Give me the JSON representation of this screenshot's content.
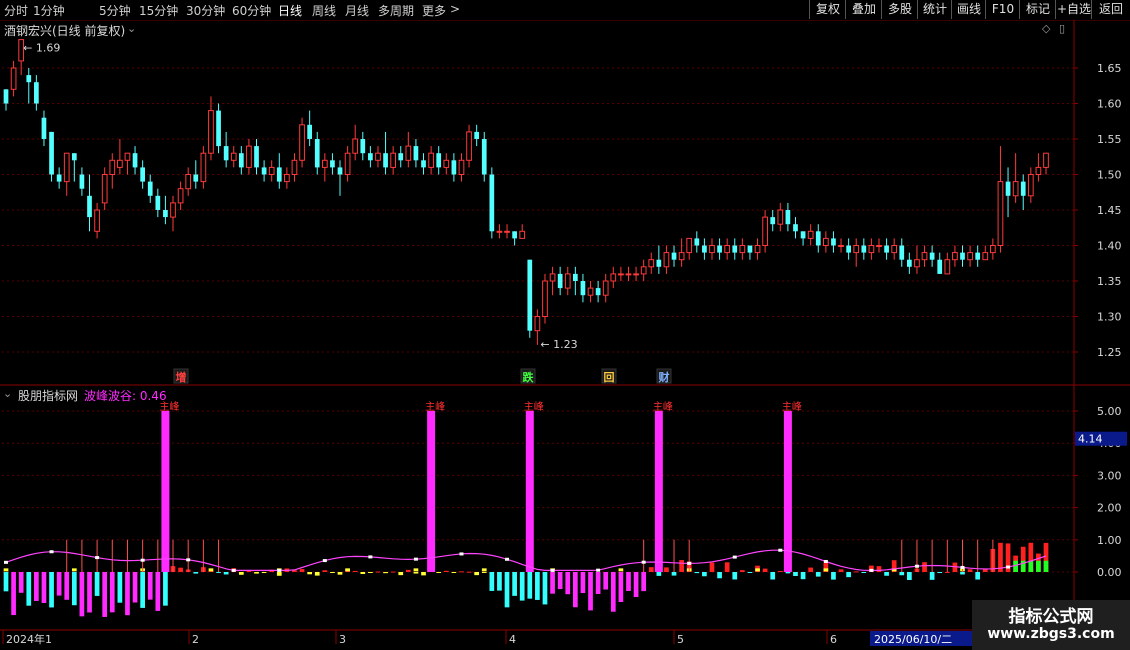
{
  "toolbar": {
    "periods": [
      "分时",
      "1分钟",
      "5分钟",
      "15分钟",
      "30分钟",
      "60分钟",
      "日线",
      "周线",
      "月线",
      "多周期",
      "更多"
    ],
    "active_period": "日线",
    "buttons": [
      "复权",
      "叠加",
      "多股",
      "统计",
      "画线",
      "F10",
      "标记",
      "+自选",
      "返回"
    ]
  },
  "main_panel": {
    "title": "酒钢宏兴(日线 前复权)",
    "max_label": "1.69",
    "min_label": "1.23",
    "y_ticks": [
      "1.65",
      "1.60",
      "1.55",
      "1.50",
      "1.45",
      "1.40",
      "1.35",
      "1.30",
      "1.25"
    ],
    "markers": [
      {
        "text": "增",
        "color": "#ff4040"
      },
      {
        "text": "跌",
        "color": "#40ff40"
      },
      {
        "text": "回",
        "color": "#ffcc44"
      },
      {
        "text": "财",
        "color": "#7fb0ff"
      }
    ]
  },
  "indicator_panel": {
    "name": "股朋指标网",
    "series_label": "波峰波谷: 0.46",
    "y_ticks": [
      "5.00",
      "4.00",
      "3.00",
      "2.00",
      "1.00",
      "0.00"
    ],
    "current_value": "4.14",
    "spike_label": "主峰"
  },
  "x_axis": {
    "labels": [
      "2024年1",
      "2",
      "3",
      "4",
      "5",
      "6"
    ],
    "date_box": "2025/06/10/二"
  },
  "watermark": {
    "line1": "指标公式网",
    "line2": "www.zbgs3.com"
  },
  "colors": {
    "up": "#ff3a3a",
    "down": "#54ffff",
    "grid": "#5a0000",
    "magenta": "#ff2bff",
    "axis": "#8a0000"
  },
  "chart_data": {
    "type": "candlestick",
    "price_axis": {
      "min": 1.23,
      "max": 1.69
    },
    "candles": [
      [
        1.62,
        1.6,
        1.62,
        1.59
      ],
      [
        1.62,
        1.65,
        1.66,
        1.61
      ],
      [
        1.66,
        1.69,
        1.69,
        1.64
      ],
      [
        1.64,
        1.63,
        1.65,
        1.6
      ],
      [
        1.63,
        1.6,
        1.64,
        1.59
      ],
      [
        1.58,
        1.55,
        1.59,
        1.54
      ],
      [
        1.56,
        1.5,
        1.56,
        1.49
      ],
      [
        1.5,
        1.49,
        1.51,
        1.48
      ],
      [
        1.49,
        1.53,
        1.53,
        1.47
      ],
      [
        1.53,
        1.52,
        1.53,
        1.49
      ],
      [
        1.5,
        1.48,
        1.51,
        1.47
      ],
      [
        1.47,
        1.44,
        1.5,
        1.42
      ],
      [
        1.42,
        1.45,
        1.46,
        1.41
      ],
      [
        1.46,
        1.5,
        1.51,
        1.45
      ],
      [
        1.5,
        1.52,
        1.53,
        1.48
      ],
      [
        1.51,
        1.52,
        1.55,
        1.5
      ],
      [
        1.52,
        1.53,
        1.53,
        1.5
      ],
      [
        1.53,
        1.51,
        1.54,
        1.5
      ],
      [
        1.51,
        1.49,
        1.52,
        1.48
      ],
      [
        1.49,
        1.47,
        1.5,
        1.46
      ],
      [
        1.47,
        1.45,
        1.48,
        1.44
      ],
      [
        1.45,
        1.44,
        1.47,
        1.43
      ],
      [
        1.44,
        1.46,
        1.47,
        1.42
      ],
      [
        1.46,
        1.48,
        1.49,
        1.45
      ],
      [
        1.48,
        1.5,
        1.51,
        1.47
      ],
      [
        1.5,
        1.49,
        1.52,
        1.48
      ],
      [
        1.49,
        1.53,
        1.54,
        1.48
      ],
      [
        1.53,
        1.59,
        1.61,
        1.52
      ],
      [
        1.59,
        1.54,
        1.6,
        1.53
      ],
      [
        1.54,
        1.52,
        1.56,
        1.51
      ],
      [
        1.52,
        1.53,
        1.54,
        1.51
      ],
      [
        1.53,
        1.51,
        1.54,
        1.5
      ],
      [
        1.51,
        1.54,
        1.55,
        1.5
      ],
      [
        1.54,
        1.51,
        1.55,
        1.5
      ],
      [
        1.51,
        1.5,
        1.52,
        1.49
      ],
      [
        1.5,
        1.51,
        1.52,
        1.49
      ],
      [
        1.51,
        1.49,
        1.53,
        1.48
      ],
      [
        1.49,
        1.5,
        1.51,
        1.48
      ],
      [
        1.5,
        1.52,
        1.53,
        1.49
      ],
      [
        1.52,
        1.57,
        1.58,
        1.51
      ],
      [
        1.57,
        1.55,
        1.59,
        1.54
      ],
      [
        1.55,
        1.51,
        1.56,
        1.5
      ],
      [
        1.51,
        1.52,
        1.53,
        1.49
      ],
      [
        1.52,
        1.51,
        1.53,
        1.5
      ],
      [
        1.51,
        1.5,
        1.52,
        1.47
      ],
      [
        1.5,
        1.53,
        1.54,
        1.49
      ],
      [
        1.53,
        1.55,
        1.57,
        1.52
      ],
      [
        1.55,
        1.53,
        1.56,
        1.52
      ],
      [
        1.53,
        1.52,
        1.54,
        1.51
      ],
      [
        1.52,
        1.53,
        1.54,
        1.51
      ],
      [
        1.53,
        1.51,
        1.56,
        1.5
      ],
      [
        1.51,
        1.53,
        1.54,
        1.5
      ],
      [
        1.53,
        1.52,
        1.54,
        1.51
      ],
      [
        1.52,
        1.54,
        1.56,
        1.51
      ],
      [
        1.54,
        1.52,
        1.55,
        1.51
      ],
      [
        1.52,
        1.51,
        1.53,
        1.5
      ],
      [
        1.51,
        1.53,
        1.54,
        1.5
      ],
      [
        1.53,
        1.51,
        1.54,
        1.5
      ],
      [
        1.51,
        1.52,
        1.53,
        1.5
      ],
      [
        1.52,
        1.5,
        1.53,
        1.49
      ],
      [
        1.5,
        1.52,
        1.53,
        1.49
      ],
      [
        1.52,
        1.56,
        1.57,
        1.51
      ],
      [
        1.56,
        1.55,
        1.57,
        1.54
      ],
      [
        1.55,
        1.5,
        1.56,
        1.49
      ],
      [
        1.5,
        1.42,
        1.51,
        1.41
      ],
      [
        1.42,
        1.42,
        1.43,
        1.41
      ],
      [
        1.42,
        1.42,
        1.43,
        1.41
      ],
      [
        1.42,
        1.41,
        1.42,
        1.4
      ],
      [
        1.41,
        1.42,
        1.43,
        1.41
      ],
      [
        1.38,
        1.28,
        1.38,
        1.27
      ],
      [
        1.28,
        1.3,
        1.31,
        1.26
      ],
      [
        1.3,
        1.35,
        1.36,
        1.29
      ],
      [
        1.35,
        1.36,
        1.37,
        1.33
      ],
      [
        1.36,
        1.34,
        1.37,
        1.33
      ],
      [
        1.34,
        1.36,
        1.37,
        1.33
      ],
      [
        1.36,
        1.35,
        1.37,
        1.33
      ],
      [
        1.35,
        1.33,
        1.36,
        1.32
      ],
      [
        1.33,
        1.34,
        1.35,
        1.32
      ],
      [
        1.34,
        1.33,
        1.35,
        1.32
      ],
      [
        1.33,
        1.35,
        1.36,
        1.32
      ],
      [
        1.35,
        1.36,
        1.37,
        1.34
      ],
      [
        1.36,
        1.36,
        1.37,
        1.35
      ],
      [
        1.36,
        1.36,
        1.37,
        1.35
      ],
      [
        1.36,
        1.36,
        1.37,
        1.35
      ],
      [
        1.36,
        1.37,
        1.38,
        1.35
      ],
      [
        1.37,
        1.38,
        1.39,
        1.36
      ],
      [
        1.38,
        1.37,
        1.4,
        1.36
      ],
      [
        1.37,
        1.39,
        1.4,
        1.36
      ],
      [
        1.39,
        1.38,
        1.4,
        1.37
      ],
      [
        1.38,
        1.39,
        1.41,
        1.37
      ],
      [
        1.39,
        1.41,
        1.41,
        1.38
      ],
      [
        1.41,
        1.4,
        1.42,
        1.39
      ],
      [
        1.4,
        1.39,
        1.41,
        1.38
      ],
      [
        1.39,
        1.4,
        1.41,
        1.38
      ],
      [
        1.4,
        1.39,
        1.41,
        1.38
      ],
      [
        1.39,
        1.4,
        1.41,
        1.38
      ],
      [
        1.4,
        1.39,
        1.41,
        1.38
      ],
      [
        1.39,
        1.4,
        1.41,
        1.38
      ],
      [
        1.4,
        1.39,
        1.4,
        1.38
      ],
      [
        1.39,
        1.4,
        1.41,
        1.38
      ],
      [
        1.4,
        1.44,
        1.45,
        1.39
      ],
      [
        1.44,
        1.43,
        1.45,
        1.42
      ],
      [
        1.43,
        1.45,
        1.46,
        1.42
      ],
      [
        1.45,
        1.43,
        1.46,
        1.42
      ],
      [
        1.43,
        1.42,
        1.44,
        1.41
      ],
      [
        1.42,
        1.41,
        1.42,
        1.4
      ],
      [
        1.41,
        1.42,
        1.43,
        1.4
      ],
      [
        1.42,
        1.4,
        1.43,
        1.39
      ],
      [
        1.4,
        1.41,
        1.42,
        1.39
      ],
      [
        1.41,
        1.4,
        1.42,
        1.39
      ],
      [
        1.4,
        1.4,
        1.41,
        1.39
      ],
      [
        1.4,
        1.39,
        1.41,
        1.38
      ],
      [
        1.39,
        1.4,
        1.41,
        1.37
      ],
      [
        1.4,
        1.39,
        1.41,
        1.38
      ],
      [
        1.39,
        1.4,
        1.41,
        1.38
      ],
      [
        1.4,
        1.4,
        1.41,
        1.39
      ],
      [
        1.4,
        1.39,
        1.41,
        1.38
      ],
      [
        1.39,
        1.4,
        1.41,
        1.38
      ],
      [
        1.4,
        1.38,
        1.41,
        1.37
      ],
      [
        1.38,
        1.37,
        1.39,
        1.36
      ],
      [
        1.37,
        1.38,
        1.4,
        1.36
      ],
      [
        1.38,
        1.39,
        1.4,
        1.37
      ],
      [
        1.39,
        1.38,
        1.4,
        1.37
      ],
      [
        1.38,
        1.36,
        1.39,
        1.36
      ],
      [
        1.36,
        1.38,
        1.39,
        1.36
      ],
      [
        1.38,
        1.39,
        1.4,
        1.37
      ],
      [
        1.39,
        1.38,
        1.4,
        1.37
      ],
      [
        1.38,
        1.39,
        1.4,
        1.37
      ],
      [
        1.39,
        1.38,
        1.4,
        1.37
      ],
      [
        1.38,
        1.39,
        1.4,
        1.38
      ],
      [
        1.39,
        1.4,
        1.41,
        1.38
      ],
      [
        1.4,
        1.49,
        1.54,
        1.39
      ],
      [
        1.49,
        1.47,
        1.51,
        1.44
      ],
      [
        1.47,
        1.49,
        1.53,
        1.46
      ],
      [
        1.49,
        1.47,
        1.5,
        1.45
      ],
      [
        1.47,
        1.5,
        1.51,
        1.46
      ],
      [
        1.5,
        1.51,
        1.53,
        1.49
      ],
      [
        1.51,
        1.53,
        1.53,
        1.5
      ]
    ],
    "x_axis_labels": [
      "2024年1",
      "2",
      "3",
      "4",
      "5",
      "6"
    ],
    "indicator": {
      "name": "波峰波谷",
      "value": 0.46,
      "ylim": [
        0,
        5
      ],
      "peaks_at": [
        21,
        56,
        69,
        86,
        103
      ]
    }
  }
}
